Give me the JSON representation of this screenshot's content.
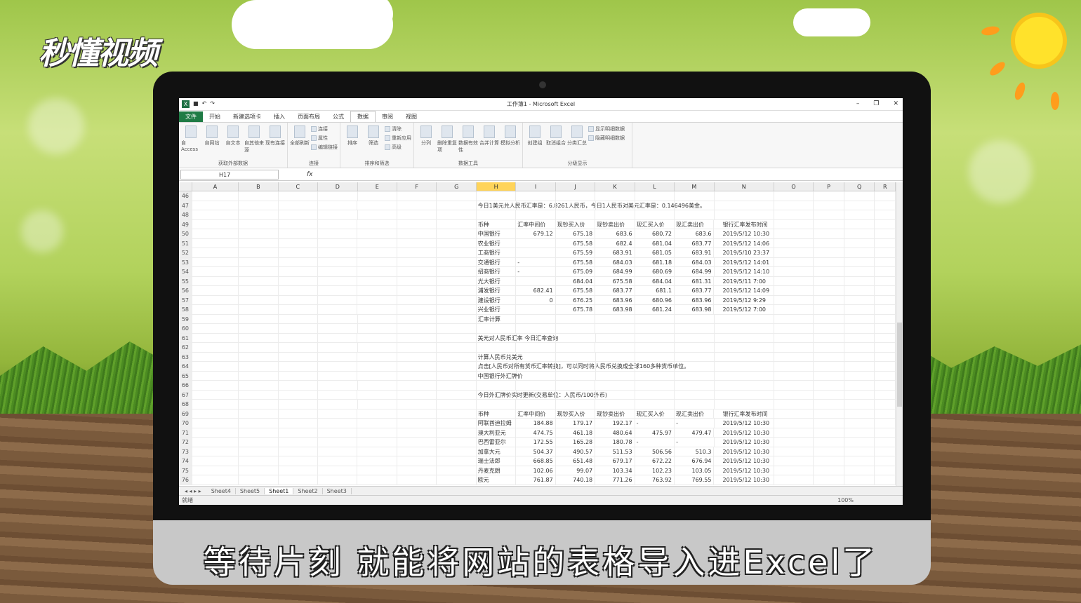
{
  "brand": {
    "logo": "秒懂视频"
  },
  "subtitle": "等待片刻  就能将网站的表格导入进Excel了",
  "excel": {
    "title": "工作簿1 - Microsoft Excel",
    "tabs": [
      "文件",
      "开始",
      "新建选项卡",
      "插入",
      "页面布局",
      "公式",
      "数据",
      "审阅",
      "视图"
    ],
    "active_tab": "数据",
    "groups": [
      {
        "label": "获取外部数据",
        "buttons": [
          "自 Access",
          "自网站",
          "自文本",
          "自其他来源",
          "现有连接"
        ]
      },
      {
        "label": "连接",
        "buttons": [
          "全部刷新",
          "连接",
          "属性",
          "编辑链接"
        ]
      },
      {
        "label": "排序和筛选",
        "buttons": [
          "排序",
          "筛选",
          "清除",
          "重新应用",
          "高级"
        ]
      },
      {
        "label": "数据工具",
        "buttons": [
          "分列",
          "删除重复项",
          "数据有效性",
          "合并计算",
          "模拟分析"
        ]
      },
      {
        "label": "分级显示",
        "buttons": [
          "创建组",
          "取消组合",
          "分类汇总",
          "显示明细数据",
          "隐藏明细数据"
        ]
      }
    ],
    "name_box": "H17",
    "fx": "fx",
    "columns": [
      "A",
      "B",
      "C",
      "D",
      "E",
      "F",
      "G",
      "H",
      "I",
      "J",
      "K",
      "L",
      "M",
      "N",
      "O",
      "P",
      "Q",
      "R"
    ],
    "selected_column": "H",
    "rows": [
      {
        "n": "46",
        "c": []
      },
      {
        "n": "47",
        "text": "今日1美元兑人民币汇率是：6.8261人民币，今日1人民币对美元汇率是：0.146496美金。"
      },
      {
        "n": "48",
        "c": []
      },
      {
        "n": "49",
        "c": [
          "币种",
          "汇率中间价",
          "现钞买入价",
          "现钞卖出价",
          "现汇买入价",
          "现汇卖出价",
          "银行汇率发布时间"
        ]
      },
      {
        "n": "50",
        "c": [
          "中国银行",
          "679.12",
          "675.18",
          "683.6",
          "680.72",
          "683.6",
          "2019/5/12 10:30"
        ]
      },
      {
        "n": "51",
        "c": [
          "农业银行",
          "",
          "675.58",
          "682.4",
          "681.04",
          "683.77",
          "2019/5/12 14:06"
        ]
      },
      {
        "n": "52",
        "c": [
          "工商银行",
          "",
          "675.59",
          "683.91",
          "681.05",
          "683.91",
          "2019/5/10 23:37"
        ]
      },
      {
        "n": "53",
        "c": [
          "交通银行",
          "-",
          "675.58",
          "684.03",
          "681.18",
          "684.03",
          "2019/5/12 14:01"
        ]
      },
      {
        "n": "54",
        "c": [
          "招商银行",
          "-",
          "675.09",
          "684.99",
          "680.69",
          "684.99",
          "2019/5/12 14:10"
        ]
      },
      {
        "n": "55",
        "c": [
          "光大银行",
          "",
          "684.04",
          "675.58",
          "684.04",
          "681.31",
          "2019/5/11 7:00"
        ]
      },
      {
        "n": "56",
        "c": [
          "浦发银行",
          "682.41",
          "675.58",
          "683.77",
          "681.1",
          "683.77",
          "2019/5/12 14:09"
        ]
      },
      {
        "n": "57",
        "c": [
          "建设银行",
          "0",
          "676.25",
          "683.96",
          "680.96",
          "683.96",
          "2019/5/12 9:29"
        ]
      },
      {
        "n": "58",
        "c": [
          "兴业银行",
          "",
          "675.78",
          "683.98",
          "681.24",
          "683.98",
          "2019/5/12 7:00"
        ]
      },
      {
        "n": "59",
        "text": "汇率计算"
      },
      {
        "n": "60",
        "c": []
      },
      {
        "n": "61",
        "text": "美元对人民币汇率  今日汇率查询"
      },
      {
        "n": "62",
        "c": []
      },
      {
        "n": "63",
        "text": "计算人民币兑美元"
      },
      {
        "n": "64",
        "text": "点击[人民币对所有货币汇率转换]，可以同时将人民币兑换成全球160多种货币单位。"
      },
      {
        "n": "65",
        "text": "中国银行外汇牌价"
      },
      {
        "n": "66",
        "c": []
      },
      {
        "n": "67",
        "text": "今日外汇牌价实时更新(交易单位：人民币/100外币)"
      },
      {
        "n": "68",
        "c": []
      },
      {
        "n": "69",
        "c": [
          "币种",
          "汇率中间价",
          "现钞买入价",
          "现钞卖出价",
          "现汇买入价",
          "现汇卖出价",
          "银行汇率发布时间"
        ]
      },
      {
        "n": "70",
        "c": [
          "阿联酋迪拉姆",
          "184.88",
          "179.17",
          "192.17",
          "-",
          "-",
          "2019/5/12 10:30"
        ]
      },
      {
        "n": "71",
        "c": [
          "澳大利亚元",
          "474.75",
          "461.18",
          "480.64",
          "475.97",
          "479.47",
          "2019/5/12 10:30"
        ]
      },
      {
        "n": "72",
        "c": [
          "巴西雷亚尔",
          "172.55",
          "165.28",
          "180.78",
          "-",
          "-",
          "2019/5/12 10:30"
        ]
      },
      {
        "n": "73",
        "c": [
          "加拿大元",
          "504.37",
          "490.57",
          "511.53",
          "506.56",
          "510.3",
          "2019/5/12 10:30"
        ]
      },
      {
        "n": "74",
        "c": [
          "瑞士法郎",
          "668.85",
          "651.48",
          "679.17",
          "672.22",
          "676.94",
          "2019/5/12 10:30"
        ]
      },
      {
        "n": "75",
        "c": [
          "丹麦克朗",
          "102.06",
          "99.07",
          "103.34",
          "102.23",
          "103.05",
          "2019/5/12 10:30"
        ]
      },
      {
        "n": "76",
        "c": [
          "欧元",
          "761.87",
          "740.18",
          "771.26",
          "763.92",
          "769.55",
          "2019/5/12 10:30"
        ]
      }
    ],
    "sheets": [
      "Sheet4",
      "Sheet5",
      "Sheet1",
      "Sheet2",
      "Sheet3"
    ],
    "active_sheet": "Sheet1",
    "status_left": "就绪",
    "zoom": "100%"
  }
}
